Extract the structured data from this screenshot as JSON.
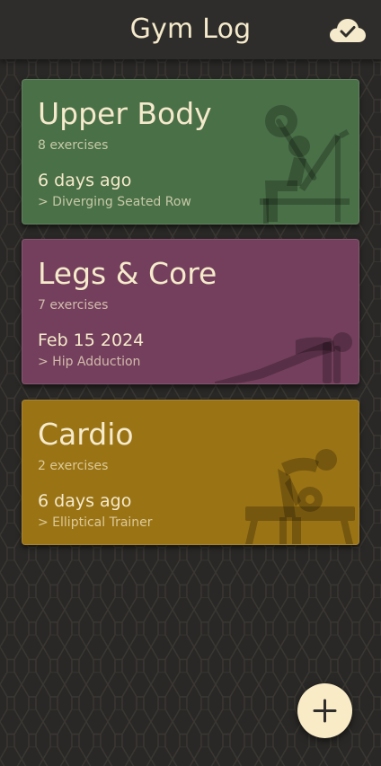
{
  "app": {
    "title": "Gym Log",
    "sync_icon": "cloud-check-icon",
    "add_icon": "plus-icon"
  },
  "colors": {
    "background": "#2c2a28",
    "topbar": "#2f2d2b",
    "text": "#f5eacb",
    "fab": "#f8ebc6"
  },
  "workouts": [
    {
      "name": "Upper Body",
      "exercises": "8 exercises",
      "last_done": "6 days ago",
      "last_exercise": "> Diverging Seated Row",
      "color": "#4a7048",
      "icon": "bench-press-icon"
    },
    {
      "name": "Legs & Core",
      "exercises": "7 exercises",
      "last_done": "Feb 15 2024",
      "last_exercise": "> Hip Adduction",
      "color": "#733f5c",
      "icon": "plank-icon"
    },
    {
      "name": "Cardio",
      "exercises": "2 exercises",
      "last_done": "6 days ago",
      "last_exercise": "> Elliptical Trainer",
      "color": "#9a7314",
      "icon": "dumbbell-row-icon"
    }
  ]
}
